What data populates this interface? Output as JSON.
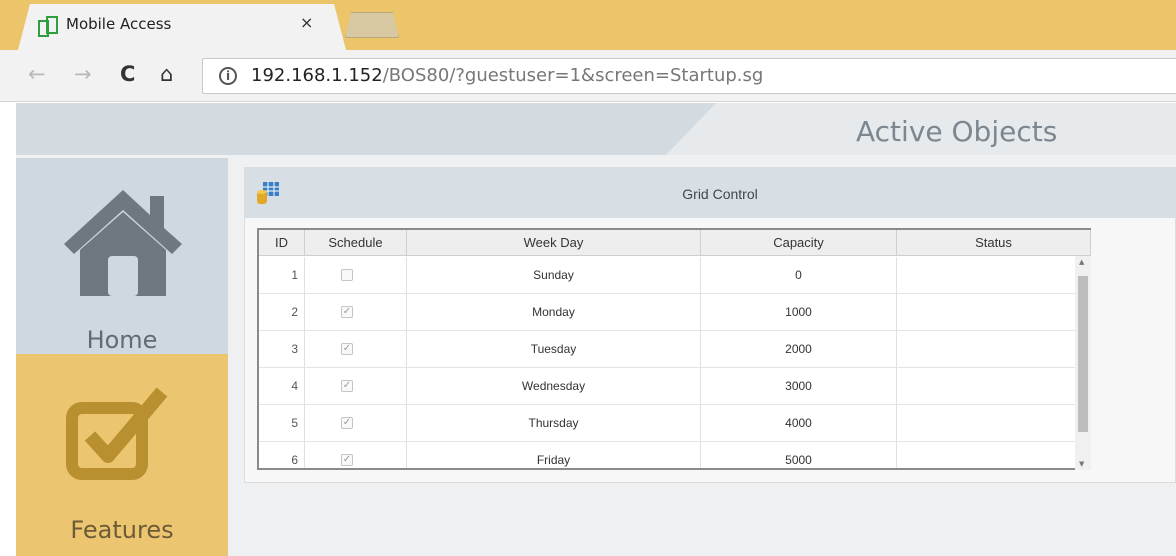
{
  "browser": {
    "tab_title": "Mobile Access",
    "tab_close": "×",
    "url_host": "192.168.1.152",
    "url_path": "/BOS80/?guestuser=1&screen=Startup.sg",
    "info_glyph": "i",
    "back_glyph": "←",
    "forward_glyph": "→",
    "reload_glyph": "C",
    "home_glyph": "⌂"
  },
  "page": {
    "title": "Active Objects"
  },
  "sidebar": {
    "items": [
      {
        "label": "Home",
        "icon": "house-icon"
      },
      {
        "label": "Features",
        "icon": "checkbox-icon"
      }
    ]
  },
  "grid": {
    "title": "Grid Control",
    "columns": [
      "ID",
      "Schedule",
      "Week Day",
      "Capacity",
      "Status"
    ],
    "rows": [
      {
        "id": "1",
        "schedule": false,
        "weekday": "Sunday",
        "capacity": "0",
        "status": ""
      },
      {
        "id": "2",
        "schedule": true,
        "weekday": "Monday",
        "capacity": "1000",
        "status": ""
      },
      {
        "id": "3",
        "schedule": true,
        "weekday": "Tuesday",
        "capacity": "2000",
        "status": ""
      },
      {
        "id": "4",
        "schedule": true,
        "weekday": "Wednesday",
        "capacity": "3000",
        "status": ""
      },
      {
        "id": "5",
        "schedule": true,
        "weekday": "Thursday",
        "capacity": "4000",
        "status": ""
      },
      {
        "id": "6",
        "schedule": true,
        "weekday": "Friday",
        "capacity": "5000",
        "status": ""
      }
    ]
  },
  "colors": {
    "accent": "#ecc570",
    "tabbar": "#ecc46a",
    "nav_home": "#cfd8de"
  }
}
